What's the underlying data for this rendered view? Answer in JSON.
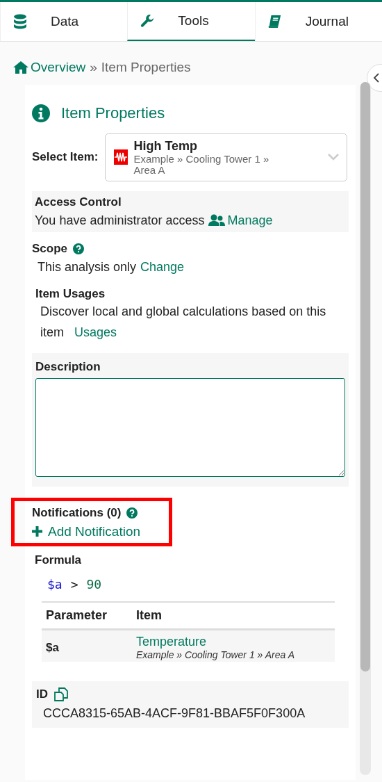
{
  "tabs": [
    {
      "label": "Data",
      "kind": "database",
      "selected": false
    },
    {
      "label": "Tools",
      "kind": "wrench",
      "selected": true
    },
    {
      "label": "Journal",
      "kind": "book",
      "selected": false
    }
  ],
  "breadcrumb": {
    "home": "Overview",
    "separator": "»",
    "current": "Item Properties"
  },
  "panel": {
    "title": "Item Properties",
    "select_item": {
      "label": "Select Item:",
      "name": "High Temp",
      "path": "Example » Cooling Tower 1 » Area A"
    },
    "access_control": {
      "title": "Access Control",
      "text": "You have administrator access",
      "link": "Manage"
    },
    "scope": {
      "title": "Scope",
      "text": "This analysis only",
      "link": "Change"
    },
    "item_usages": {
      "title": "Item Usages",
      "text": "Discover local and global calculations based on this item",
      "link": "Usages"
    },
    "description": {
      "title": "Description"
    },
    "notifications": {
      "title": "Notifications (0)",
      "link": "Add Notification",
      "highlighted": true
    },
    "formula": {
      "title": "Formula",
      "tokens": [
        {
          "text": "$a",
          "kind": "variable"
        },
        {
          "text": ">",
          "kind": "operator"
        },
        {
          "text": "90",
          "kind": "number"
        }
      ],
      "columns": [
        "Parameter",
        "Item"
      ],
      "rows": [
        {
          "parameter": "$a",
          "item": "Temperature",
          "path": "Example » Cooling Tower 1 » Area A"
        }
      ]
    },
    "id": {
      "title": "ID",
      "value": "CCCA8315-65AB-4ACF-9F81-BBAF5F0F300A"
    }
  }
}
